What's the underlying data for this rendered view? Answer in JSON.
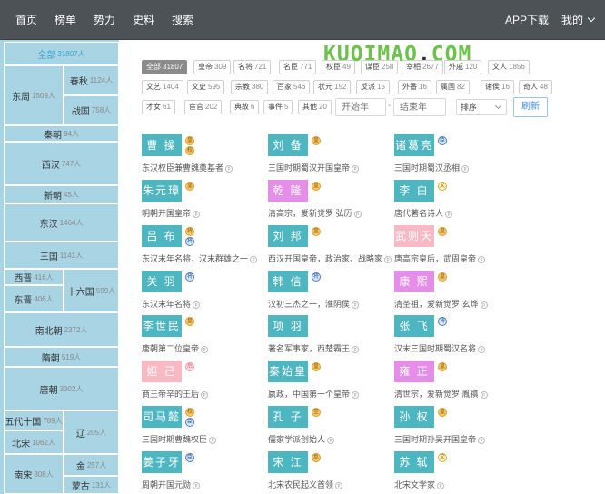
{
  "nav": {
    "items": [
      "首页",
      "榜单",
      "势力",
      "史料",
      "搜索"
    ],
    "app_download": "APP下载",
    "mine": "我的"
  },
  "logo": {
    "text": "KUOIMAO",
    "dot": ".",
    "suffix": "COM"
  },
  "sidebar": {
    "cells": [
      {
        "label": "全部",
        "count": "31807人",
        "active": true
      },
      {
        "label": "东周",
        "count": "1509人"
      },
      {
        "label": "春秋",
        "count": "1124人"
      },
      {
        "label": "战国",
        "count": "758人"
      },
      {
        "label": "秦朝",
        "count": "94人"
      },
      {
        "label": "西汉",
        "count": "747人"
      },
      {
        "label": "新朝",
        "count": "45人"
      },
      {
        "label": "东汉",
        "count": "1464人"
      },
      {
        "label": "三国",
        "count": "1141人"
      },
      {
        "label": "西晋",
        "count": "416人"
      },
      {
        "label": "东晋",
        "count": "406人"
      },
      {
        "label": "十六国",
        "count": "599人"
      },
      {
        "label": "南北朝",
        "count": "2372人"
      },
      {
        "label": "隋朝",
        "count": "519人"
      },
      {
        "label": "唐朝",
        "count": "3302人"
      },
      {
        "label": "五代十国",
        "count": "789人"
      },
      {
        "label": "辽",
        "count": "205人"
      },
      {
        "label": "北宋",
        "count": "1062人"
      },
      {
        "label": "金",
        "count": "257人"
      },
      {
        "label": "南宋",
        "count": "808人"
      },
      {
        "label": "蒙古",
        "count": "131人"
      }
    ]
  },
  "filters": {
    "tags": [
      {
        "label": "全部",
        "count": "31807",
        "selected": true
      },
      {
        "label": "皇帝",
        "count": "309"
      },
      {
        "label": "名将",
        "count": "721"
      },
      {
        "label": "名臣",
        "count": "771"
      },
      {
        "label": "权臣",
        "count": "49"
      },
      {
        "label": "谋臣",
        "count": "258"
      },
      {
        "label": "宰相",
        "count": "2677"
      },
      {
        "label": "外戚",
        "count": "120"
      },
      {
        "label": "文人",
        "count": "1856"
      },
      {
        "label": "文艺",
        "count": "1404"
      },
      {
        "label": "文史",
        "count": "595"
      },
      {
        "label": "宗教",
        "count": "380"
      },
      {
        "label": "百家",
        "count": "546"
      },
      {
        "label": "状元",
        "count": "152"
      },
      {
        "label": "反派",
        "count": "15"
      },
      {
        "label": "外番",
        "count": "16"
      },
      {
        "label": "属国",
        "count": "82"
      },
      {
        "label": "诸侯",
        "count": "16"
      },
      {
        "label": "奇人",
        "count": "48"
      },
      {
        "label": "才女",
        "count": "61"
      },
      {
        "label": "宦官",
        "count": "202"
      },
      {
        "label": "典故",
        "count": "6"
      },
      {
        "label": "事件",
        "count": "5"
      },
      {
        "label": "其他",
        "count": "20"
      }
    ],
    "start_year_placeholder": "开始年",
    "end_year_placeholder": "结束年",
    "sep": "-",
    "sort_label": "排序",
    "refresh_label": "刷新"
  },
  "people": [
    {
      "name": "曹 操",
      "desc": "东汉权臣兼曹魏奠基者",
      "color": "teal",
      "badges": [
        {
          "c": "gold",
          "t": "皇"
        },
        {
          "c": "gold",
          "t": "权"
        }
      ]
    },
    {
      "name": "刘 备",
      "desc": "三国时期蜀汉开国皇帝",
      "color": "teal",
      "badges": [
        {
          "c": "gold",
          "t": "皇"
        }
      ]
    },
    {
      "name": "诸葛亮",
      "desc": "三国时期蜀汉丞相",
      "color": "teal",
      "badges": [
        {
          "c": "blue",
          "t": "臣"
        }
      ]
    },
    {
      "name": "朱元璋",
      "desc": "明朝开国皇帝",
      "color": "teal",
      "badges": [
        {
          "c": "gold",
          "t": "皇"
        }
      ]
    },
    {
      "name": "乾 隆",
      "desc": "清高宗，爱新觉罗 弘历",
      "color": "purple",
      "badges": [
        {
          "c": "gold",
          "t": "皇"
        }
      ]
    },
    {
      "name": "李 白",
      "desc": "唐代著名诗人",
      "color": "teal",
      "badges": [
        {
          "c": "green",
          "t": "文"
        }
      ]
    },
    {
      "name": "吕 布",
      "desc": "东汉末年名将，汉末群雄之一",
      "color": "teal",
      "badges": [
        {
          "c": "gold",
          "t": "将"
        },
        {
          "c": "blue",
          "t": "将"
        }
      ]
    },
    {
      "name": "刘 邦",
      "desc": "西汉开国皇帝，政治家、战略家",
      "color": "teal",
      "badges": [
        {
          "c": "gold",
          "t": "皇"
        }
      ]
    },
    {
      "name": "武则天",
      "desc": "唐高宗皇后，武周皇帝",
      "color": "pink",
      "badges": [
        {
          "c": "gold",
          "t": "皇"
        }
      ]
    },
    {
      "name": "关 羽",
      "desc": "东汉末年名将",
      "color": "teal",
      "badges": [
        {
          "c": "blue",
          "t": "将"
        }
      ]
    },
    {
      "name": "韩 信",
      "desc": "汉初三杰之一，淮阴侯",
      "color": "teal",
      "badges": [
        {
          "c": "blue",
          "t": "将"
        }
      ]
    },
    {
      "name": "康 熙",
      "desc": "清圣祖，爱新觉罗 玄烨",
      "color": "purple",
      "badges": [
        {
          "c": "gold",
          "t": "皇"
        }
      ]
    },
    {
      "name": "李世民",
      "desc": "唐朝第二位皇帝",
      "color": "teal",
      "badges": [
        {
          "c": "gold",
          "t": "皇"
        }
      ]
    },
    {
      "name": "项 羽",
      "desc": "著名军事家，西楚霸王",
      "color": "teal",
      "badges": []
    },
    {
      "name": "张 飞",
      "desc": "汉末三国时期蜀汉名将",
      "color": "teal",
      "badges": [
        {
          "c": "blue",
          "t": "将"
        }
      ]
    },
    {
      "name": "妲 己",
      "desc": "商王帝辛的王后",
      "color": "pink",
      "badges": [
        {
          "c": "pink",
          "t": "后"
        }
      ]
    },
    {
      "name": "秦始皇",
      "desc": "嬴政，中国第一个皇帝",
      "color": "teal",
      "badges": [
        {
          "c": "gold",
          "t": "皇"
        }
      ]
    },
    {
      "name": "雍 正",
      "desc": "清世宗，爱新觉罗 胤禛",
      "color": "purple",
      "badges": [
        {
          "c": "gold",
          "t": "皇"
        }
      ]
    },
    {
      "name": "司马懿",
      "desc": "三国时期曹魏权臣",
      "color": "teal",
      "badges": [
        {
          "c": "gold",
          "t": "权"
        },
        {
          "c": "blue",
          "t": "臣"
        }
      ]
    },
    {
      "name": "孔 子",
      "desc": "儒家学派创始人",
      "color": "teal",
      "badges": [
        {
          "c": "gold",
          "t": "圣"
        }
      ]
    },
    {
      "name": "孙 权",
      "desc": "三国时期孙吴开国皇帝",
      "color": "teal",
      "badges": [
        {
          "c": "gold",
          "t": "皇"
        }
      ]
    },
    {
      "name": "姜子牙",
      "desc": "周朝开国元勋",
      "color": "teal",
      "badges": [
        {
          "c": "blue",
          "t": "臣"
        }
      ]
    },
    {
      "name": "宋 江",
      "desc": "北宋农民起义首领",
      "color": "teal",
      "badges": [
        {
          "c": "gold",
          "t": "反"
        }
      ]
    },
    {
      "name": "苏 轼",
      "desc": "北宋文学家",
      "color": "teal",
      "badges": [
        {
          "c": "green",
          "t": "文"
        }
      ]
    }
  ],
  "icons": {
    "pc": "pc-icon",
    "chevron": "chevron-down-icon"
  }
}
